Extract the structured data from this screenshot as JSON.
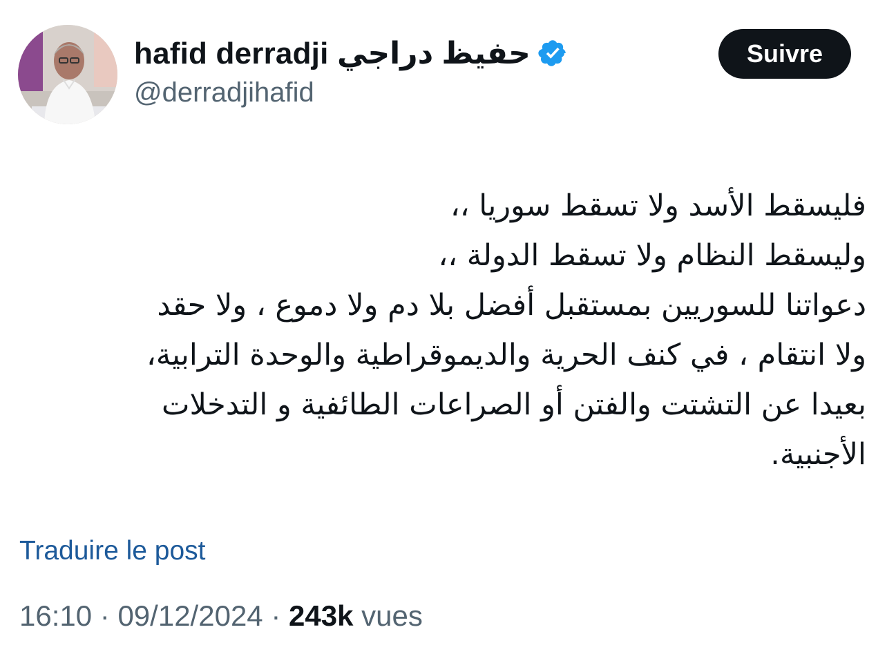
{
  "author": {
    "display_name": "hafid derradji حفيظ دراجي",
    "handle": "@derradjihafid",
    "verified": true,
    "verified_color": "#1d9bf0"
  },
  "follow_button": {
    "label": "Suivre",
    "background": "#0f1419",
    "text_color": "#ffffff"
  },
  "post": {
    "lines": [
      "فليسقط الأسد ولا تسقط سوريا ،،",
      "وليسقط النظام ولا تسقط الدولة ،،",
      "دعواتنا للسوريين بمستقبل أفضل بلا دم ولا دموع ، ولا حقد",
      "ولا انتقام ، في كنف الحرية والديموقراطية والوحدة الترابية،",
      "بعيدا عن التشتت والفتن أو الصراعات الطائفية و التدخلات",
      "الأجنبية."
    ]
  },
  "translate": {
    "label": "Traduire le post",
    "color": "#1d5a9a"
  },
  "meta": {
    "time": "16:10",
    "separator": "·",
    "date": "09/12/2024",
    "views_count": "243k",
    "views_label": "vues"
  },
  "icons": {
    "verified": "verified-badge-icon"
  }
}
